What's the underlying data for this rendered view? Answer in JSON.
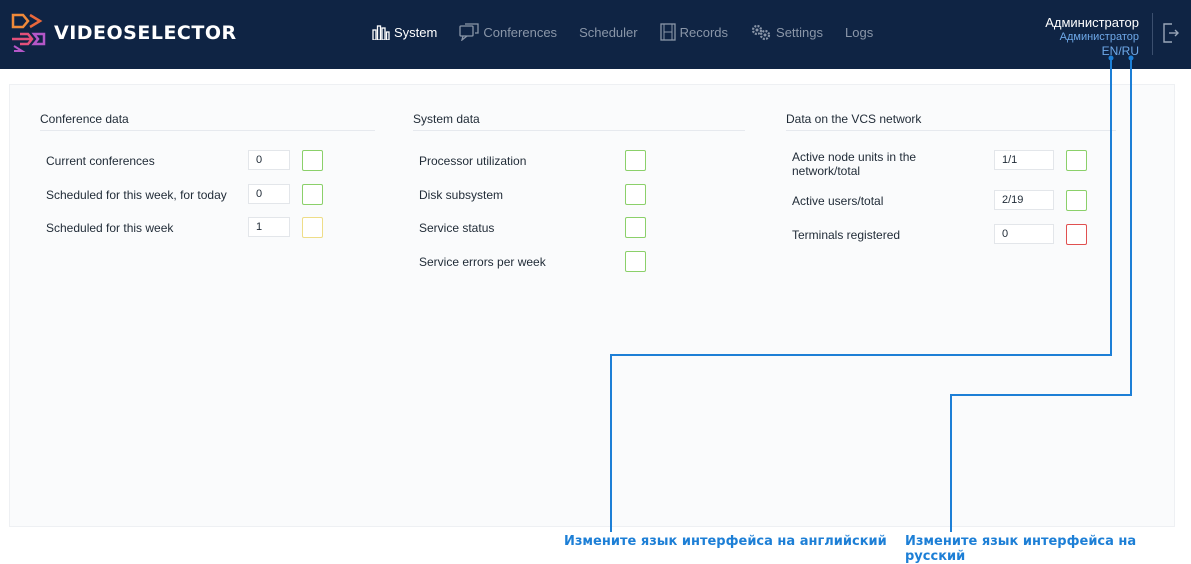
{
  "app": {
    "brand": "VIDEOSELECTOR"
  },
  "nav": {
    "system": "System",
    "conferences": "Conferences",
    "scheduler": "Scheduler",
    "records": "Records",
    "settings": "Settings",
    "logs": "Logs",
    "active": "System"
  },
  "user": {
    "name": "Администратор",
    "role": "Администратор",
    "lang": "EN/RU"
  },
  "conference_data": {
    "title": "Conference data",
    "rows": [
      {
        "label": "Current conferences",
        "value": "0",
        "status": "green"
      },
      {
        "label": "Scheduled for this week, for today",
        "value": "0",
        "status": "green"
      },
      {
        "label": "Scheduled for this week",
        "value": "1",
        "status": "yellow"
      }
    ]
  },
  "system_data": {
    "title": "System data",
    "rows": [
      {
        "label": "Processor utilization",
        "status": "green"
      },
      {
        "label": "Disk subsystem",
        "status": "green"
      },
      {
        "label": "Service status",
        "status": "green"
      },
      {
        "label": "Service errors per week",
        "status": "green"
      }
    ]
  },
  "vcs_data": {
    "title": "Data on the VCS network",
    "rows": [
      {
        "label": "Active node units in the network/total",
        "value": "1/1",
        "status": "green"
      },
      {
        "label": "Active users/total",
        "value": "2/19",
        "status": "green"
      },
      {
        "label": "Terminals registered",
        "value": "0",
        "status": "red"
      }
    ]
  },
  "annotations": {
    "english": "Измените язык интерфейса на английский",
    "russian": "Измените язык интерфейса на русский"
  },
  "colors": {
    "header_bg": "#0f2444",
    "status_green": "#8bd06a",
    "status_yellow": "#eedd88",
    "status_red": "#e05050",
    "annotation_blue": "#1d7fd6"
  }
}
